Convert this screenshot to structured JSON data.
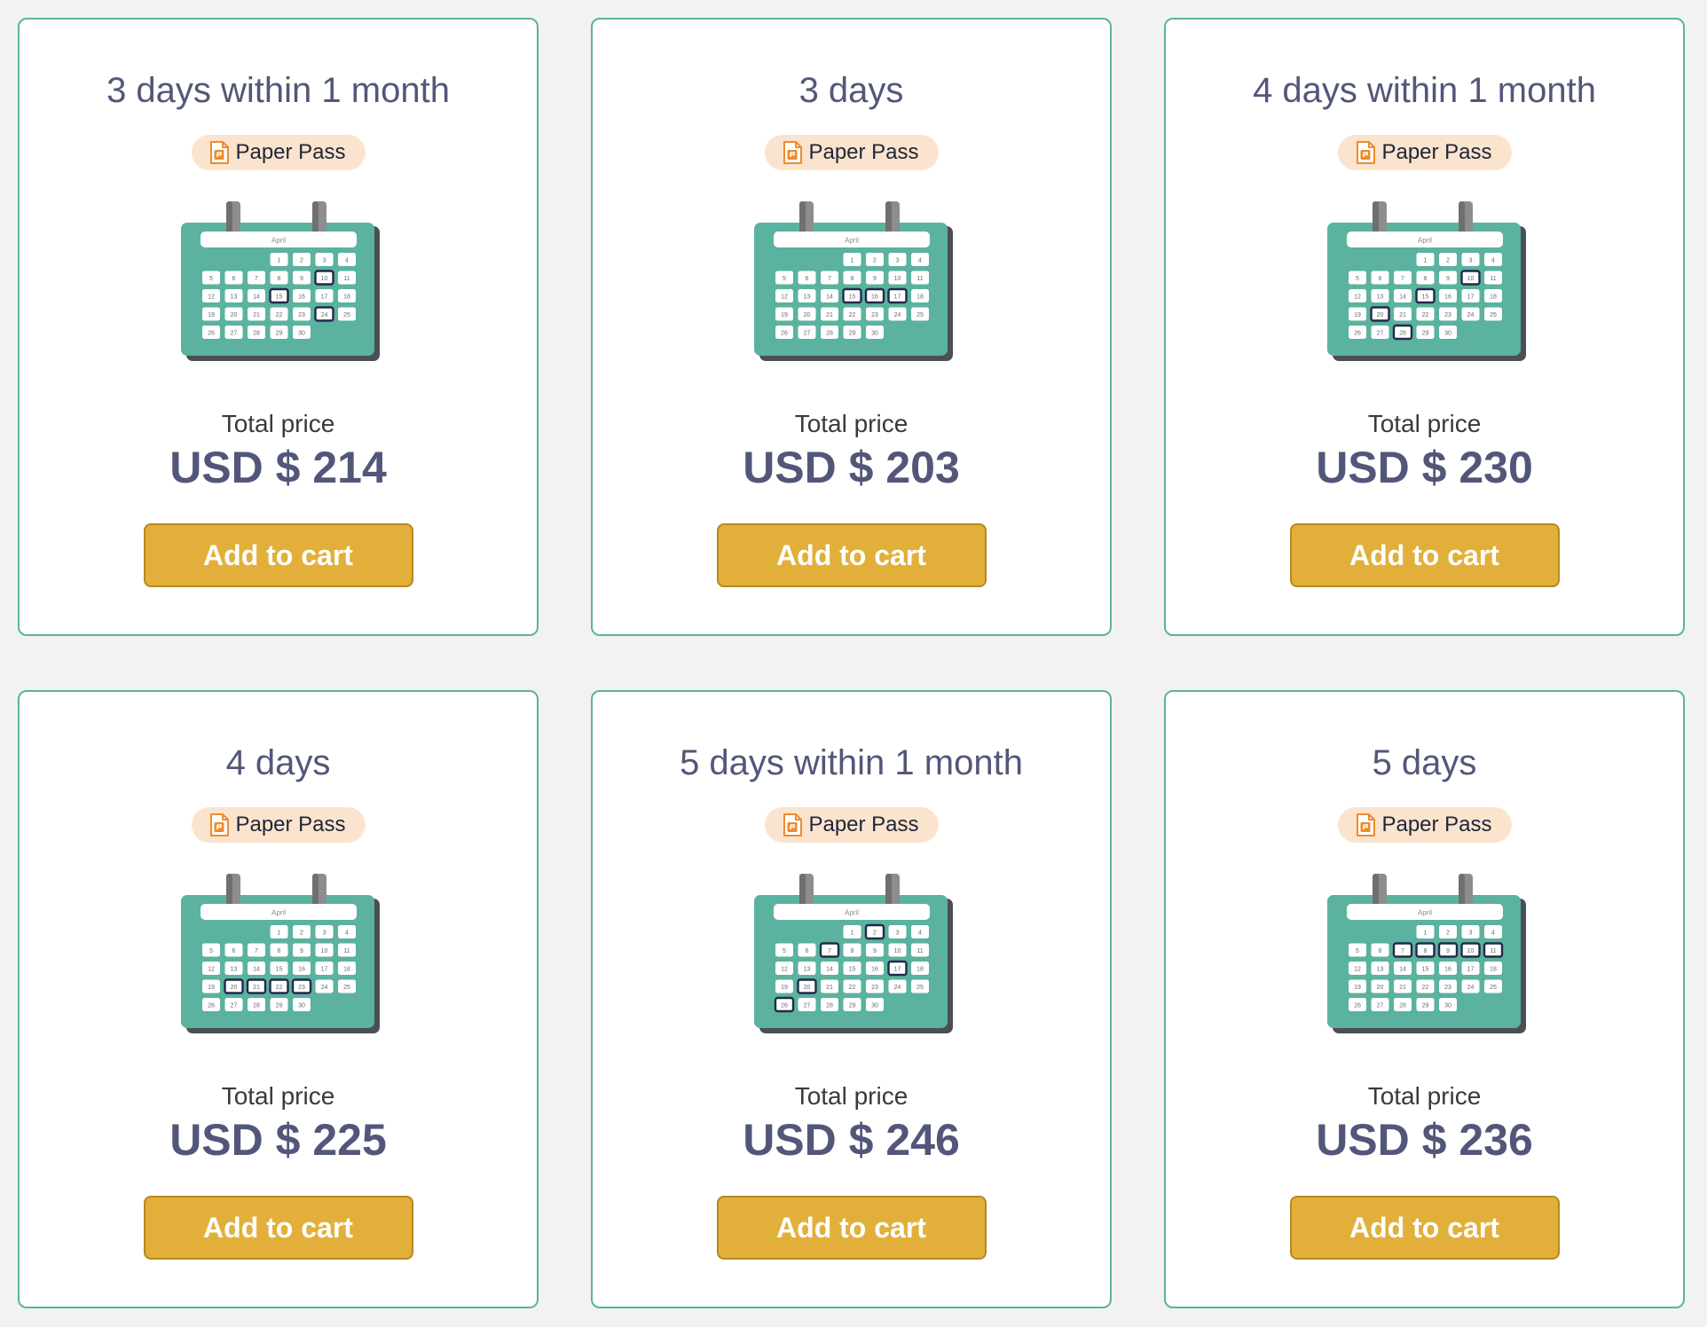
{
  "colors": {
    "page_background": "#f2f2f2",
    "card_border": "#5bb29f",
    "title_text": "#52577a",
    "badge_background": "#fbe4cd",
    "badge_icon": "#f08a2a",
    "button_background": "#e2b03a",
    "button_border": "#b88722",
    "calendar_body": "#5bb29f",
    "calendar_selected_outline": "#23294a"
  },
  "calendar_common": {
    "month": "April",
    "first_weekday_index": 3,
    "days_in_month": 30
  },
  "cards": [
    {
      "title": "3 days within 1 month",
      "badge": {
        "label": "Paper Pass",
        "icon": "paper-pass-icon"
      },
      "selected_days": [
        10,
        15,
        24
      ],
      "price_label": "Total price",
      "price": "USD $ 214",
      "button_label": "Add to cart"
    },
    {
      "title": "3 days",
      "badge": {
        "label": "Paper Pass",
        "icon": "paper-pass-icon"
      },
      "selected_days": [
        15,
        16,
        17
      ],
      "price_label": "Total price",
      "price": "USD $ 203",
      "button_label": "Add to cart"
    },
    {
      "title": "4 days within 1 month",
      "badge": {
        "label": "Paper Pass",
        "icon": "paper-pass-icon"
      },
      "selected_days": [
        10,
        15,
        20,
        28
      ],
      "price_label": "Total price",
      "price": "USD $ 230",
      "button_label": "Add to cart"
    },
    {
      "title": "4 days",
      "badge": {
        "label": "Paper Pass",
        "icon": "paper-pass-icon"
      },
      "selected_days": [
        20,
        21,
        22,
        23
      ],
      "price_label": "Total price",
      "price": "USD $ 225",
      "button_label": "Add to cart"
    },
    {
      "title": "5 days within 1 month",
      "badge": {
        "label": "Paper Pass",
        "icon": "paper-pass-icon"
      },
      "selected_days": [
        2,
        7,
        17,
        20,
        26
      ],
      "price_label": "Total price",
      "price": "USD $ 246",
      "button_label": "Add to cart"
    },
    {
      "title": "5 days",
      "badge": {
        "label": "Paper Pass",
        "icon": "paper-pass-icon"
      },
      "selected_days": [
        7,
        8,
        9,
        10,
        11
      ],
      "price_label": "Total price",
      "price": "USD $ 236",
      "button_label": "Add to cart"
    }
  ]
}
